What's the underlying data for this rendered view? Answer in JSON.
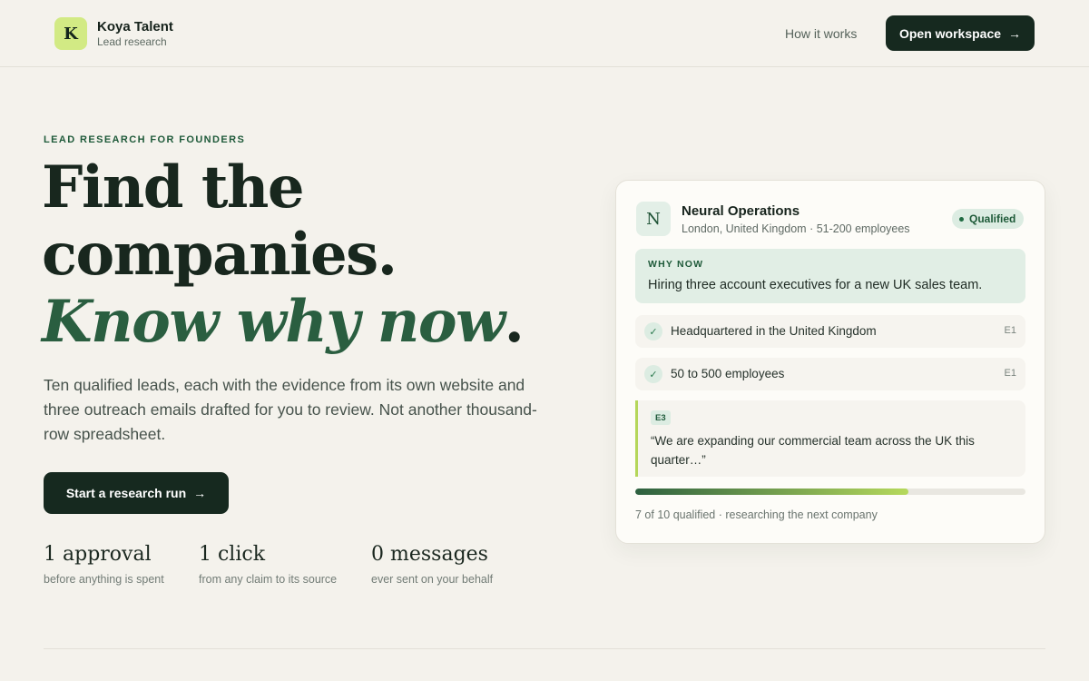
{
  "brand": {
    "logo_letter": "K",
    "name": "Koya Talent",
    "subtitle": "Lead research"
  },
  "nav": {
    "how_it_works": "How it works",
    "open_workspace": "Open workspace",
    "arrow": "→"
  },
  "hero": {
    "eyebrow": "LEAD RESEARCH FOR FOUNDERS",
    "headline_line1": "Find the",
    "headline_line2": "companies.",
    "headline_line3": "Know why now",
    "headline_period": ".",
    "lede": "Ten qualified leads, each with the evidence from its own website and three outreach emails drafted for you to review. Not another thousand-row spreadsheet.",
    "cta": "Start a research run",
    "cta_arrow": "→"
  },
  "stats": [
    {
      "value": "1 approval",
      "label": "before anything is spent"
    },
    {
      "value": "1 click",
      "label": "from any claim to its source"
    },
    {
      "value": "0 messages",
      "label": "ever sent on your behalf"
    }
  ],
  "card": {
    "avatar_letter": "N",
    "company": "Neural Operations",
    "meta": "London, United Kingdom · 51-200 employees",
    "status": "Qualified",
    "why_now_label": "WHY NOW",
    "why_now_text": "Hiring three account executives for a new UK sales team.",
    "checks": [
      {
        "icon": "check-icon",
        "text": "Headquartered in the United Kingdom",
        "evidence": "E1"
      },
      {
        "icon": "check-icon",
        "text": "50 to 500 employees",
        "evidence": "E1"
      }
    ],
    "quote_tag": "E3",
    "quote_text": "“We are expanding our commercial team across the UK this quarter…”",
    "progress": {
      "qualified": 7,
      "total": 10,
      "fraction": 0.7
    },
    "progress_caption": "7 of 10 qualified · researching the next company"
  },
  "colors": {
    "background": "#f4f2ec",
    "dark_button": "#16291f",
    "accent_green": "#2a5e40",
    "lime": "#d2ea84"
  }
}
